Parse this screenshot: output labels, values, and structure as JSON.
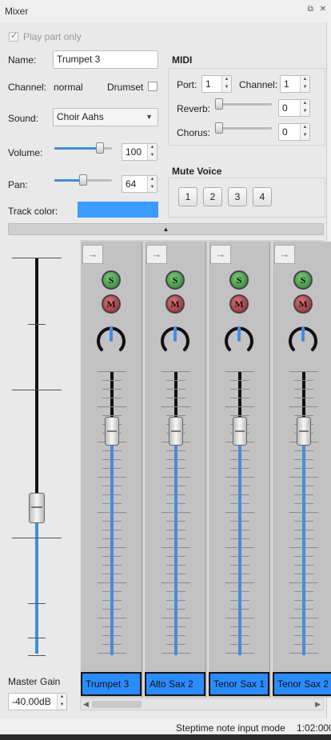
{
  "window": {
    "title": "Mixer",
    "icons": [
      "restore-icon",
      "close-icon"
    ]
  },
  "part": {
    "play_part_only": "Play part only",
    "name_label": "Name:",
    "name_value": "Trumpet 3",
    "channel_label": "Channel:",
    "channel_value": "normal",
    "drumset_label": "Drumset",
    "sound_label": "Sound:",
    "sound_value": "Choir Aahs",
    "volume_label": "Volume:",
    "volume_value": "100",
    "volume_level": 0.79,
    "pan_label": "Pan:",
    "pan_value": "64",
    "pan_level": 0.5,
    "track_color_label": "Track color:",
    "track_color": "#3d9bff"
  },
  "midi": {
    "title": "MIDI",
    "port_label": "Port:",
    "port_value": "1",
    "channel_label": "Channel:",
    "channel_value": "1",
    "reverb_label": "Reverb:",
    "reverb_value": "0",
    "chorus_label": "Chorus:",
    "chorus_value": "0"
  },
  "mute_voice": {
    "title": "Mute Voice",
    "voices": [
      "1",
      "2",
      "3",
      "4"
    ]
  },
  "master": {
    "label": "Master Gain",
    "value": "-40.00dB",
    "level": 0.37
  },
  "strips": [
    {
      "name": "Trumpet 3",
      "solo": "S",
      "mute": "M",
      "volume_level": 0.79
    },
    {
      "name": "Alto Sax 2",
      "solo": "S",
      "mute": "M",
      "volume_level": 0.79
    },
    {
      "name": "Tenor Sax 1",
      "solo": "S",
      "mute": "M",
      "volume_level": 0.79
    },
    {
      "name": "Tenor Sax 2",
      "solo": "S",
      "mute": "M",
      "volume_level": 0.79
    }
  ],
  "status": {
    "mode": "Steptime note input mode",
    "time": "1:02:000"
  },
  "colors": {
    "accent": "#3d8fe0",
    "solo": "#2e7d32",
    "mute": "#8b2323",
    "label_bg": "#2a8cff"
  }
}
